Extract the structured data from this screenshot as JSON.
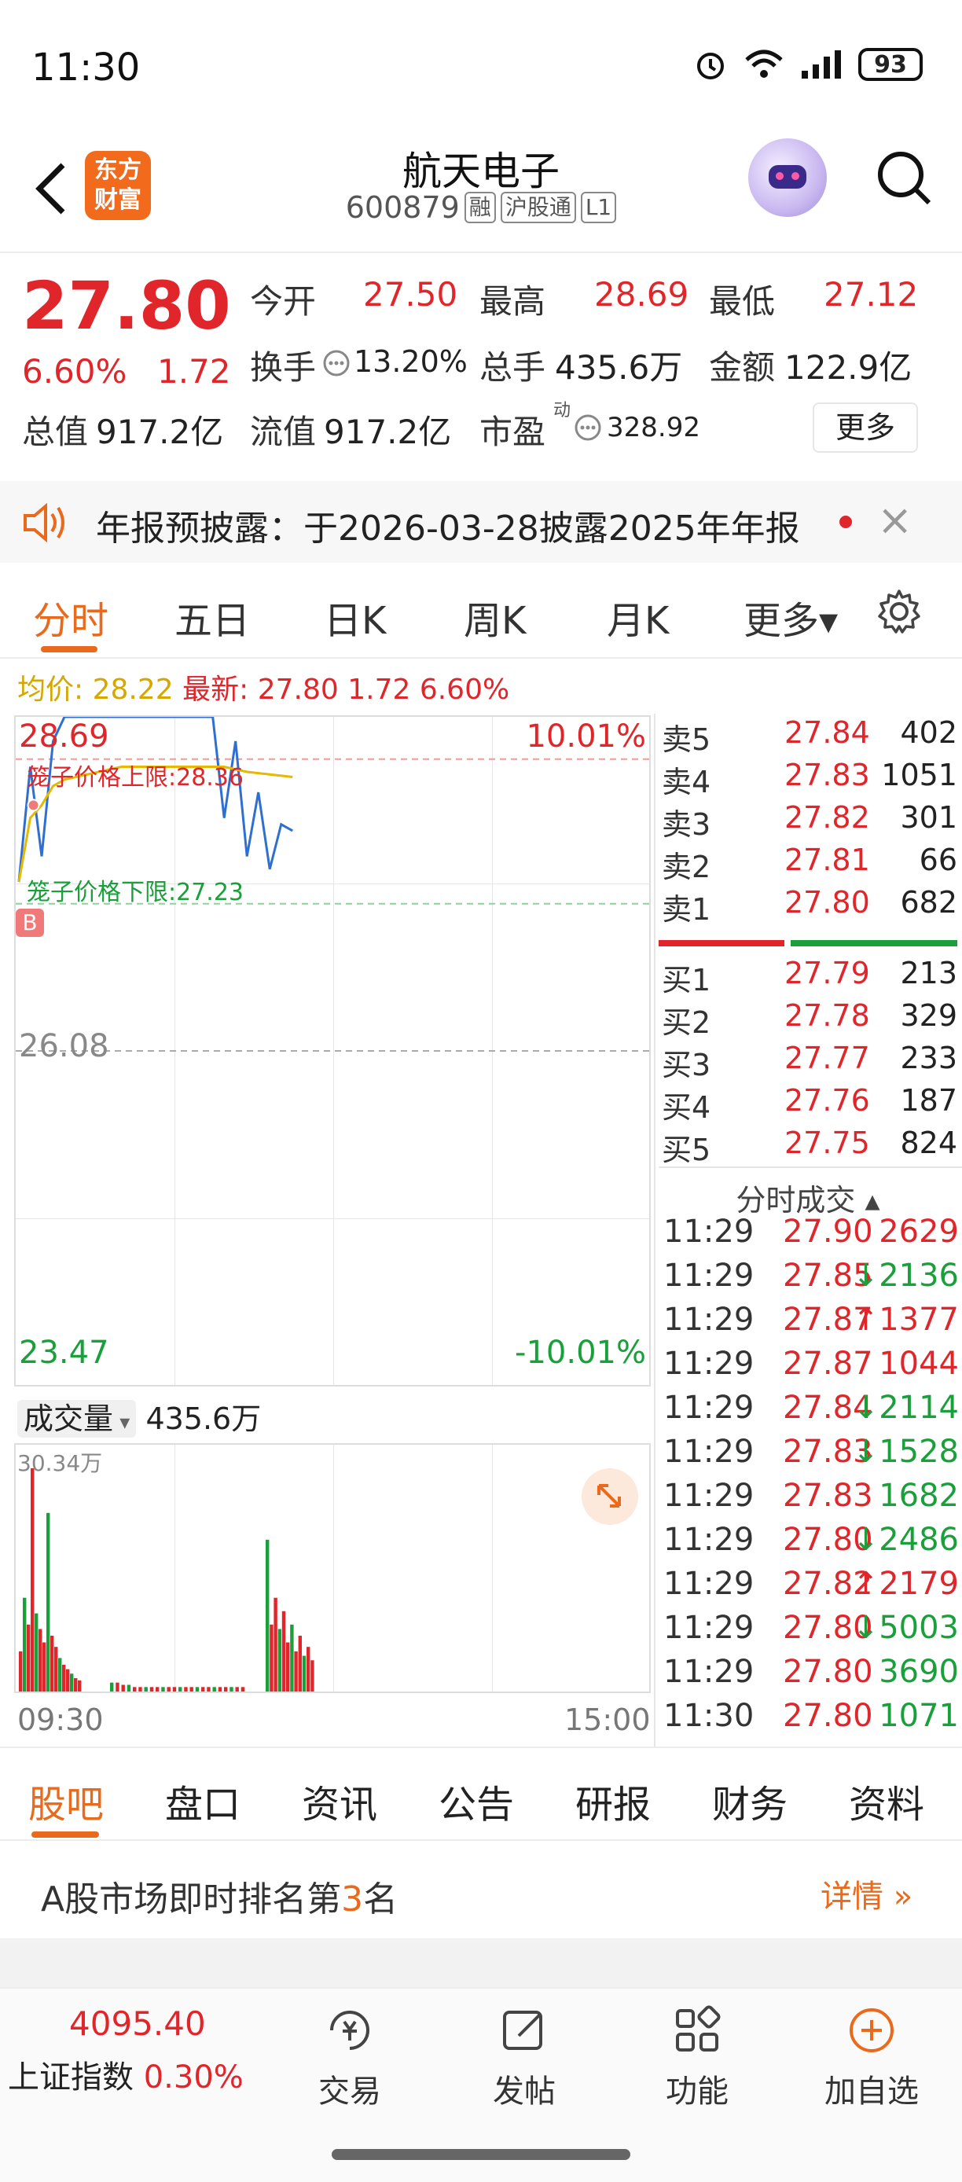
{
  "status": {
    "time": "11:30",
    "battery": "93"
  },
  "header": {
    "logo": "东方\n财富",
    "logo_line1": "东方",
    "logo_line2": "财富",
    "name": "航天电子",
    "code": "600879",
    "tags": [
      "融",
      "沪股通",
      "L1"
    ]
  },
  "quote": {
    "price": "27.80",
    "pct": "6.60%",
    "change": "1.72",
    "open_label": "今开",
    "open": "27.50",
    "high_label": "最高",
    "high": "28.69",
    "low_label": "最低",
    "low": "27.12",
    "turnover_label": "换手",
    "turnover": "13.20%",
    "volume_label": "总手",
    "volume": "435.6万",
    "amount_label": "金额",
    "amount": "122.9亿",
    "mktcap_label": "总值",
    "mktcap": "917.2亿",
    "float_label": "流值",
    "float": "917.2亿",
    "pe_label": "市盈",
    "pe_sup": "动",
    "pe": "328.92",
    "more_label": "更多"
  },
  "notice": {
    "text": "年报预披露：于2026-03-28披露2025年年报"
  },
  "chart_tabs": [
    "分时",
    "五日",
    "日K",
    "周K",
    "月K",
    "更多▾"
  ],
  "info": {
    "avg_label": "均价:",
    "avg": "28.22",
    "latest_label": "最新:",
    "latest": "27.80",
    "change": "1.72",
    "pct": "6.60%"
  },
  "chart": {
    "top_price": "28.69",
    "top_pct": "10.01%",
    "mid_price": "26.08",
    "bottom_price": "23.47",
    "bottom_pct": "-10.01%",
    "upper_cage": "笼子价格上限:28.36",
    "lower_cage": "笼子价格下限:27.23",
    "buy_mark": "B"
  },
  "chart_data": {
    "type": "line",
    "title": "",
    "ylim": [
      23.47,
      28.69
    ],
    "series": [
      {
        "values": [
          27.4,
          28.3,
          27.6,
          28.5,
          28.69,
          28.69,
          28.69,
          28.69,
          28.69,
          28.69,
          28.69,
          28.69,
          28.69,
          28.69,
          28.69,
          28.69,
          28.69,
          28.69,
          27.9,
          28.5,
          27.6,
          28.1,
          27.5,
          27.85,
          27.8
        ]
      },
      {
        "values": [
          27.4,
          27.9,
          28.0,
          28.15,
          28.2,
          28.22,
          28.24,
          28.26,
          28.28,
          28.3,
          28.3,
          28.3,
          28.3,
          28.3,
          28.3,
          28.3,
          28.3,
          28.3,
          28.3,
          28.28,
          28.26,
          28.25,
          28.24,
          28.23,
          28.22
        ]
      }
    ],
    "volume_max": "30.34万",
    "volume": [
      18,
      42,
      30,
      100,
      35,
      28,
      22,
      80,
      25,
      20,
      15,
      12,
      10,
      8,
      6,
      5,
      4,
      4,
      3,
      3,
      2,
      2,
      2,
      2,
      2,
      2,
      2,
      2,
      2,
      2,
      2,
      2,
      2,
      2,
      2,
      2,
      2,
      2,
      2,
      2,
      68,
      30,
      42,
      28,
      36,
      22,
      30,
      18,
      25,
      16,
      20,
      14
    ]
  },
  "volume_header": {
    "label": "成交量",
    "value": "435.6万"
  },
  "time_axis": {
    "start": "09:30",
    "end": "15:00"
  },
  "order_book": {
    "asks": [
      {
        "label": "卖5",
        "price": "27.84",
        "vol": "402"
      },
      {
        "label": "卖4",
        "price": "27.83",
        "vol": "1051"
      },
      {
        "label": "卖3",
        "price": "27.82",
        "vol": "301"
      },
      {
        "label": "卖2",
        "price": "27.81",
        "vol": "66"
      },
      {
        "label": "卖1",
        "price": "27.80",
        "vol": "682"
      }
    ],
    "bids": [
      {
        "label": "买1",
        "price": "27.79",
        "vol": "213"
      },
      {
        "label": "买2",
        "price": "27.78",
        "vol": "329"
      },
      {
        "label": "买3",
        "price": "27.77",
        "vol": "233"
      },
      {
        "label": "买4",
        "price": "27.76",
        "vol": "187"
      },
      {
        "label": "买5",
        "price": "27.75",
        "vol": "824"
      }
    ]
  },
  "ticks_title": "分时成交 ▴",
  "ticks": [
    {
      "time": "11:29",
      "price": "27.90",
      "vol": "2629",
      "dir": "",
      "pc": "red",
      "vc": "red"
    },
    {
      "time": "11:29",
      "price": "27.85",
      "vol": "↓2136",
      "dir": "down",
      "pc": "red",
      "vc": "green"
    },
    {
      "time": "11:29",
      "price": "27.87",
      "vol": "↑1377",
      "dir": "up",
      "pc": "red",
      "vc": "red"
    },
    {
      "time": "11:29",
      "price": "27.87",
      "vol": "1044",
      "dir": "",
      "pc": "red",
      "vc": "red"
    },
    {
      "time": "11:29",
      "price": "27.84",
      "vol": "↓2114",
      "dir": "down",
      "pc": "red",
      "vc": "green"
    },
    {
      "time": "11:29",
      "price": "27.83",
      "vol": "↓1528",
      "dir": "down",
      "pc": "red",
      "vc": "green"
    },
    {
      "time": "11:29",
      "price": "27.83",
      "vol": "1682",
      "dir": "",
      "pc": "red",
      "vc": "green"
    },
    {
      "time": "11:29",
      "price": "27.80",
      "vol": "↓2486",
      "dir": "down",
      "pc": "red",
      "vc": "green"
    },
    {
      "time": "11:29",
      "price": "27.82",
      "vol": "↑2179",
      "dir": "up",
      "pc": "red",
      "vc": "red"
    },
    {
      "time": "11:29",
      "price": "27.80",
      "vol": "↓5003",
      "dir": "down",
      "pc": "red",
      "vc": "green"
    },
    {
      "time": "11:29",
      "price": "27.80",
      "vol": "3690",
      "dir": "",
      "pc": "red",
      "vc": "green"
    },
    {
      "time": "11:30",
      "price": "27.80",
      "vol": "1071",
      "dir": "",
      "pc": "red",
      "vc": "green"
    }
  ],
  "bottom_tabs": [
    "股吧",
    "盘口",
    "资讯",
    "公告",
    "研报",
    "财务",
    "资料"
  ],
  "rank": {
    "prefix": "A股市场即时排名第",
    "rank": "3",
    "suffix": "名",
    "detail": "详情 »"
  },
  "bottom_nav": {
    "index_value": "4095.40",
    "index_name": "上证指数",
    "index_pct": "0.30%",
    "items": [
      "交易",
      "发帖",
      "功能",
      "加自选"
    ]
  },
  "colors": {
    "up": "#e0262b",
    "down": "#19a03a",
    "accent": "#e96a1c",
    "avg_line": "#e6b800",
    "price_line": "#2f6fd1"
  }
}
